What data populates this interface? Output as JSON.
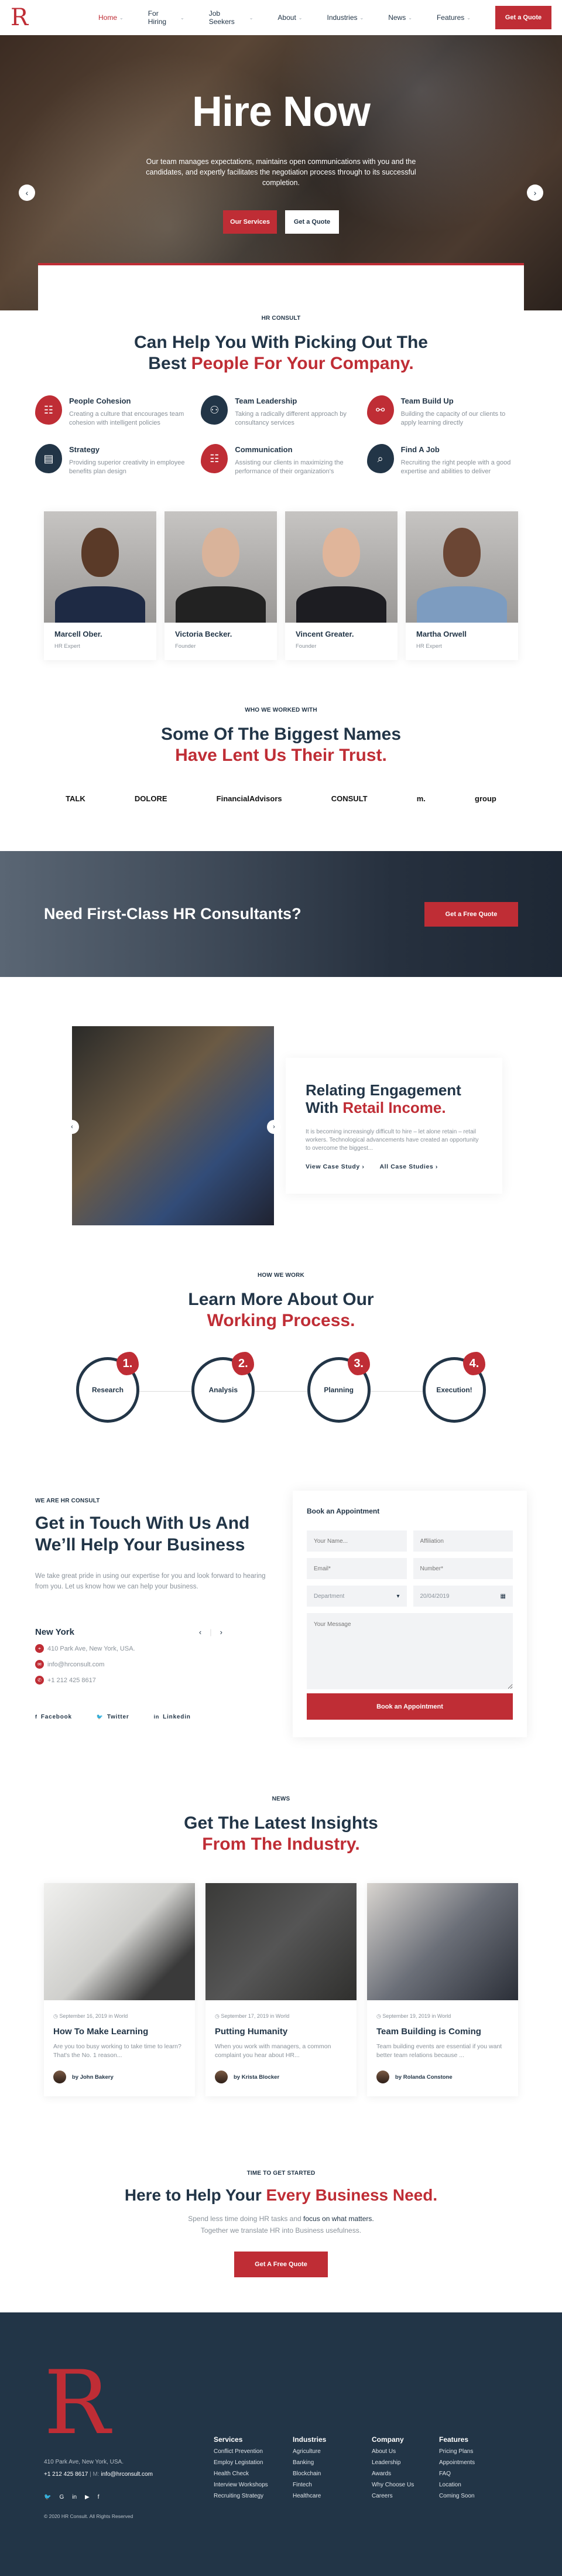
{
  "colors": {
    "accent": "#bf2d35",
    "navy": "#223547"
  },
  "header": {
    "logo": "R",
    "nav": [
      {
        "label": "Home",
        "active": true
      },
      {
        "label": "For Hiring"
      },
      {
        "label": "Job Seekers"
      },
      {
        "label": "About"
      },
      {
        "label": "Industries"
      },
      {
        "label": "News"
      },
      {
        "label": "Features"
      }
    ],
    "cta": "Get a Quote"
  },
  "hero": {
    "title": "Hire Now",
    "text": "Our team manages expectations, maintains open communications with you and the candidates, and expertly facilitates the negotiation process through to its successful completion.",
    "btn_primary": "Our Services",
    "btn_secondary": "Get a Quote",
    "prev": "‹",
    "next": "›"
  },
  "intro": {
    "kicker": "HR CONSULT",
    "title_line1": "Can Help You With Picking Out The",
    "title_line2_a": "Best ",
    "title_line2_b": "People For Your Company.",
    "features": [
      {
        "title": "People Cohesion",
        "text": "Creating a culture that encourages team cohesion with intelligent policies",
        "icon": "clipboard-icon",
        "color": "r"
      },
      {
        "title": "Team Leadership",
        "text": "Taking a radically different approach by consultancy services",
        "icon": "team-icon",
        "color": "n"
      },
      {
        "title": "Team Build Up",
        "text": "Building the capacity of our clients to apply learning directly",
        "icon": "hierarchy-icon",
        "color": "r"
      },
      {
        "title": "Strategy",
        "text": "Providing superior creativity in employee benefits plan design",
        "icon": "presentation-icon",
        "color": "n"
      },
      {
        "title": "Communication",
        "text": "Assisting our clients in maximizing the performance of their organization's",
        "icon": "clipboard-icon",
        "color": "r"
      },
      {
        "title": "Find A Job",
        "text": "Recruiting the right people with a good expertise and abilities to deliver",
        "icon": "search-person-icon",
        "color": "n"
      }
    ]
  },
  "team": [
    {
      "name": "Marcell Ober.",
      "role": "HR Expert"
    },
    {
      "name": "Victoria Becker.",
      "role": "Founder"
    },
    {
      "name": "Vincent Greater.",
      "role": "Founder"
    },
    {
      "name": "Martha Orwell",
      "role": "HR Expert"
    }
  ],
  "clients": {
    "kicker": "WHO WE WORKED WITH",
    "title_line1": "Some Of The Biggest Names",
    "title_line2": "Have Lent Us Their Trust.",
    "logos": [
      "TALK",
      "DOLORE",
      "FinancialAdvisors",
      "CONSULT",
      "m.",
      "group"
    ]
  },
  "band": {
    "title": "Need First-Class HR Consultants?",
    "cta": "Get a Free Quote"
  },
  "case_study": {
    "title_a": "Relating Engagement",
    "title_b1": "With ",
    "title_b2": "Retail Income.",
    "text": "It is becoming increasingly difficult to hire – let alone retain – retail workers. Technological advancements have created an opportunity to overcome the biggest...",
    "link1": "View Case Study ›",
    "link2": "All Case Studies ›",
    "prev": "‹",
    "next": "›"
  },
  "process": {
    "kicker": "HOW WE WORK",
    "title_line1": "Learn More About Our",
    "title_line2": "Working Process.",
    "steps": [
      {
        "num": "1.",
        "label": "Research"
      },
      {
        "num": "2.",
        "label": "Analysis"
      },
      {
        "num": "3.",
        "label": "Planning"
      },
      {
        "num": "4.",
        "label": "Execution!"
      }
    ]
  },
  "contact": {
    "kicker": "WE ARE HR CONSULT",
    "title": "Get in Touch With Us And We’ll Help Your Business",
    "text": "We take great pride in using our expertise for you and look forward to hearing from you. Let us know how we can help your business.",
    "city": "New York",
    "address": "410 Park Ave, New York, USA.",
    "email": "info@hrconsult.com",
    "phone": "+1 212 425 8617",
    "prev": "‹",
    "next": "›",
    "social": [
      {
        "icon": "f",
        "label": "Facebook"
      },
      {
        "icon": "🐦",
        "label": "Twitter"
      },
      {
        "icon": "in",
        "label": "Linkedin"
      }
    ]
  },
  "form": {
    "title": "Book an Appointment",
    "name_ph": "Your Name...",
    "affiliation_ph": "Affiliation",
    "email_ph": "Email*",
    "number_ph": "Number*",
    "department": "Department",
    "date": "20/04/2019",
    "message_ph": "Your Message",
    "submit": "Book an Appointment"
  },
  "news": {
    "kicker": "NEWS",
    "title_line1": "Get The Latest Insights",
    "title_line2": "From The Industry.",
    "posts": [
      {
        "date": "September 16, 2019 in World",
        "title": "How To Make Learning",
        "text": "Are you too busy working to take time to learn? That's the No. 1 reason...",
        "author": "by John Bakery"
      },
      {
        "date": "September 17, 2019 in World",
        "title": "Putting Humanity",
        "text": "When you work with managers, a common complaint you hear about HR...",
        "author": "by Krista Blocker"
      },
      {
        "date": "September 19, 2019 in World",
        "title": "Team Building is Coming",
        "text": "Team building events are essential if you want better team relations because ...",
        "author": "by Rolanda Constone"
      }
    ]
  },
  "start": {
    "kicker": "TIME TO GET STARTED",
    "title_a": "Here to Help Your ",
    "title_b": "Every Business Need.",
    "text_a": "Spend less time doing HR tasks and ",
    "text_b": "focus on what matters.",
    "text_c": " Together we translate HR into Business usefulness.",
    "cta": "Get A Free Quote"
  },
  "footer": {
    "logo": "R",
    "address": "410 Park Ave, New York, USA.",
    "phone": "+1 212 425 8617",
    "mail_label": " | M: ",
    "email": "info@hrconsult.com",
    "social": [
      "twitter",
      "google",
      "linkedin",
      "youtube",
      "facebook"
    ],
    "copyright": "© 2020 HR Consult. All Rights Reserved",
    "columns": [
      {
        "title": "Services",
        "items": [
          "Conflict Prevention",
          "Employ Legistation",
          "Health Check",
          "Interview Workshops",
          "Recruiting Strategy"
        ]
      },
      {
        "title": "Industries",
        "items": [
          "Agriculture",
          "Banking",
          "Blockchain",
          "Fintech",
          "Healthcare"
        ]
      },
      {
        "title": "Company",
        "items": [
          "About Us",
          "Leadership",
          "Awards",
          "Why Choose Us",
          "Careers"
        ]
      },
      {
        "title": "Features",
        "items": [
          "Pricing Plans",
          "Appointments",
          "FAQ",
          "Location",
          "Coming Soon"
        ]
      }
    ]
  }
}
